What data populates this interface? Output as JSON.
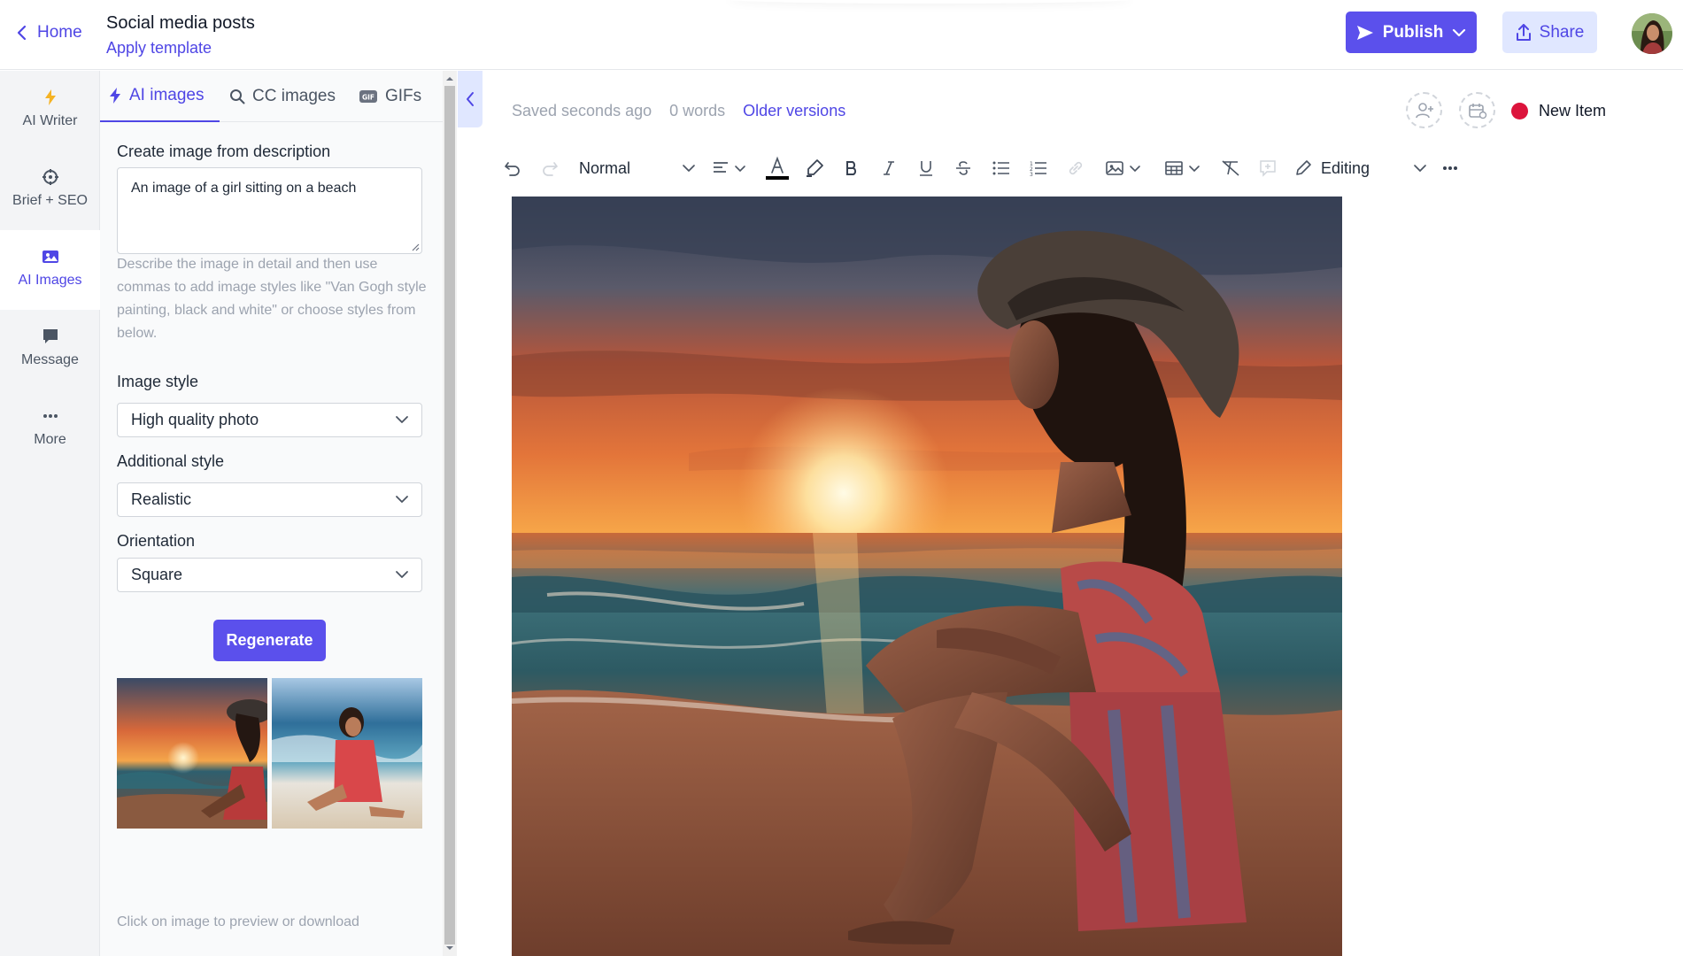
{
  "header": {
    "home_label": "Home",
    "doc_title": "Social media posts",
    "apply_template": "Apply template",
    "publish_label": "Publish",
    "share_label": "Share"
  },
  "rail": {
    "items": [
      {
        "label": "AI Writer",
        "icon": "lightning-icon"
      },
      {
        "label": "Brief + SEO",
        "icon": "crosshair-icon"
      },
      {
        "label": "AI Images",
        "icon": "image-icon",
        "active": true
      },
      {
        "label": "Message",
        "icon": "message-icon"
      },
      {
        "label": "More",
        "icon": "more-icon"
      }
    ]
  },
  "panel": {
    "tabs": [
      {
        "label": "AI images",
        "active": true
      },
      {
        "label": "CC images"
      },
      {
        "label": "GIFs"
      }
    ],
    "create_label": "Create image from description",
    "prompt_value": "An image of a girl sitting on a beach",
    "help_text": "Describe the image in detail and then use commas to add image styles like \"Van Gogh style painting, black and white\" or choose styles from below.",
    "image_style_label": "Image style",
    "image_style_value": "High quality photo",
    "additional_style_label": "Additional style",
    "additional_style_value": "Realistic",
    "orientation_label": "Orientation",
    "orientation_value": "Square",
    "regenerate_label": "Regenerate",
    "thumb_caption": "Click on image to preview or download"
  },
  "editor": {
    "saved": "Saved seconds ago",
    "words": "0 words",
    "older_versions": "Older versions",
    "new_item": "New Item",
    "paragraph_style": "Normal",
    "mode": "Editing"
  },
  "colors": {
    "accent": "#5b50ec",
    "accent_text": "#4f46e5",
    "accent_light": "#e0e7ff",
    "status_dot": "#dc143c"
  }
}
